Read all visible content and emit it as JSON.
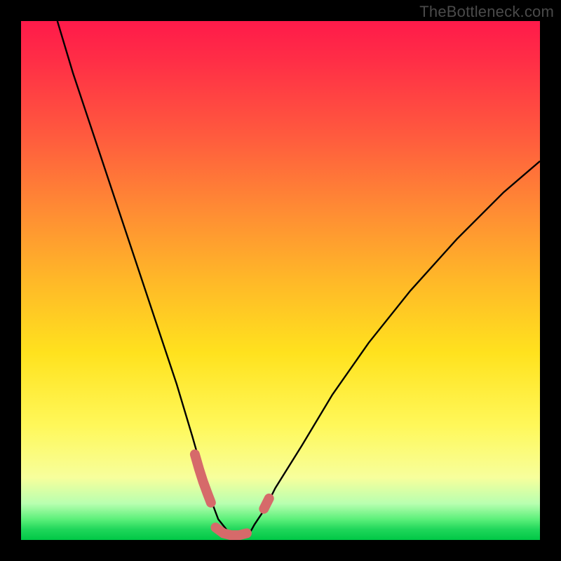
{
  "watermark": "TheBottleneck.com",
  "chart_data": {
    "type": "line",
    "title": "",
    "xlabel": "",
    "ylabel": "",
    "xlim": [
      0,
      100
    ],
    "ylim": [
      0,
      100
    ],
    "grid": false,
    "legend": false,
    "series": [
      {
        "name": "bottleneck-curve",
        "x": [
          7,
          10,
          14,
          18,
          22,
          26,
          30,
          33,
          35,
          36.5,
          38,
          40,
          42,
          44,
          45,
          47,
          49,
          54,
          60,
          67,
          75,
          84,
          93,
          100
        ],
        "values": [
          100,
          90,
          78,
          66,
          54,
          42,
          30,
          20,
          13,
          8,
          4,
          1.5,
          0.8,
          1.2,
          3,
          6,
          10,
          18,
          28,
          38,
          48,
          58,
          67,
          73
        ]
      }
    ],
    "markers": [
      {
        "name": "left-thick-segment",
        "x": [
          33.5,
          34.3,
          35.1,
          35.9,
          36.6
        ],
        "y": [
          16.5,
          13.7,
          11.2,
          9.0,
          7.2
        ]
      },
      {
        "name": "bottom-thick-segment",
        "x": [
          37.5,
          39.0,
          40.5,
          42.0,
          43.5
        ],
        "y": [
          2.4,
          1.3,
          0.9,
          0.9,
          1.3
        ]
      },
      {
        "name": "right-thick-dot",
        "x": [
          46.8,
          47.8
        ],
        "y": [
          6.0,
          8.0
        ]
      }
    ],
    "colors": {
      "curve": "#000000",
      "markers": "#d66a6a",
      "gradient_top": "#ff1a4a",
      "gradient_bottom": "#00c846"
    }
  }
}
